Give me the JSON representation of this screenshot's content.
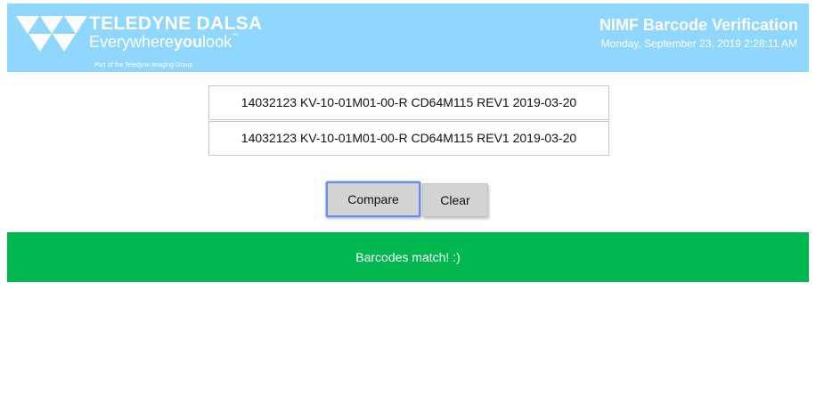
{
  "header": {
    "logo": {
      "icon": "teledyne-logo-mark-icon",
      "brand_name": "TELEDYNE DALSA",
      "tagline_prefix": "Everywhere",
      "tagline_bold": "you",
      "tagline_suffix": "look",
      "tagline_mark": "™",
      "group_text": "Part of the Teledyne Imaging Group"
    },
    "title": "NIMF Barcode Verification",
    "datetime": "Monday, September 23, 2019 2:28:11 AM",
    "background_color": "#8fd7ff"
  },
  "form": {
    "barcode_1": "14032123 KV-10-01M01-00-R CD64M115 REV1 2019-03-20",
    "barcode_2": "14032123 KV-10-01M01-00-R CD64M115 REV1 2019-03-20"
  },
  "buttons": {
    "compare_label": "Compare",
    "clear_label": "Clear"
  },
  "result": {
    "message": "Barcodes match! :)",
    "color": "#00b84f"
  }
}
